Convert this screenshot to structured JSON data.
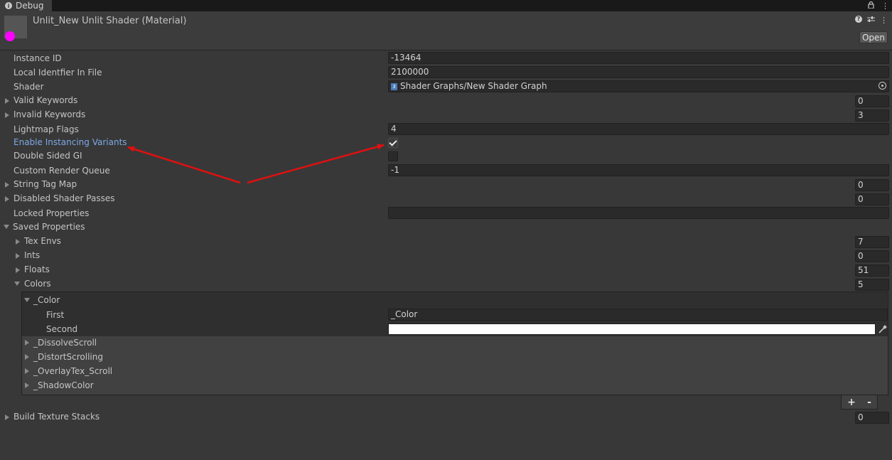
{
  "tab": {
    "title": "Debug",
    "icons": [
      "lock-icon",
      "more-icon"
    ]
  },
  "header": {
    "title": "Unlit_New Unlit Shader (Material)",
    "open_label": "Open",
    "icons": [
      "help-icon",
      "settings-icon",
      "more-icon"
    ],
    "thumb_color": "#ff00ff"
  },
  "props": {
    "instance_id": {
      "label": "Instance ID",
      "value": "-13464"
    },
    "local_id": {
      "label": "Local Identfier In File",
      "value": "2100000"
    },
    "shader": {
      "label": "Shader",
      "value": "Shader Graphs/New Shader Graph",
      "icon_text": "3"
    },
    "valid_keywords": {
      "label": "Valid Keywords",
      "value": "0"
    },
    "invalid_keywords": {
      "label": "Invalid Keywords",
      "value": "3"
    },
    "lightmap_flags": {
      "label": "Lightmap Flags",
      "value": "4"
    },
    "instancing": {
      "label": "Enable Instancing Variants",
      "checked": true
    },
    "double_sided_gi": {
      "label": "Double Sided GI",
      "checked": false
    },
    "render_queue": {
      "label": "Custom Render Queue",
      "value": "-1"
    },
    "string_tag_map": {
      "label": "String Tag Map",
      "value": "0"
    },
    "disabled_passes": {
      "label": "Disabled Shader Passes",
      "value": "0"
    },
    "locked_props": {
      "label": "Locked Properties",
      "value": ""
    },
    "saved_props": {
      "label": "Saved Properties"
    },
    "tex_envs": {
      "label": "Tex Envs",
      "value": "7"
    },
    "ints": {
      "label": "Ints",
      "value": "0"
    },
    "floats": {
      "label": "Floats",
      "value": "51"
    },
    "colors": {
      "label": "Colors",
      "value": "5"
    },
    "color_item": {
      "label": "_Color",
      "first_label": "First",
      "first_value": "_Color",
      "second_label": "Second",
      "second_color": "#ffffff"
    },
    "color_list": [
      "_DissolveScroll",
      "_DistortScrolling",
      "_OverlayTex_Scroll",
      "_ShadowColor"
    ],
    "list_add": "+",
    "list_remove": "-",
    "build_texture_stacks": {
      "label": "Build Texture Stacks",
      "value": "0"
    }
  },
  "annotation": {
    "arrow_color": "#e01010"
  }
}
